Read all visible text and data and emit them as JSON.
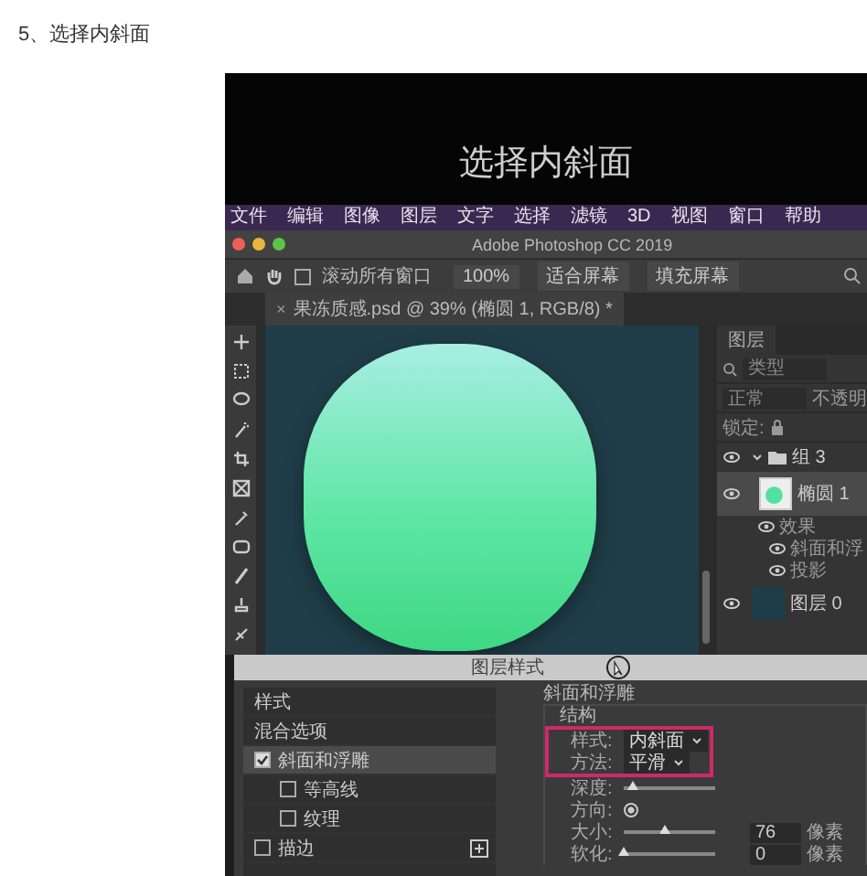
{
  "step_heading": "5、选择内斜面",
  "video": {
    "caption": "选择内斜面",
    "menu_bar": [
      "文件",
      "编辑",
      "图像",
      "图层",
      "文字",
      "选择",
      "滤镜",
      "3D",
      "视图",
      "窗口",
      "帮助"
    ],
    "title": "Adobe Photoshop CC 2019",
    "options_bar": {
      "scroll_all": {
        "label": "滚动所有窗口",
        "checked": false
      },
      "buttons": [
        "100%",
        "适合屏幕",
        "填充屏幕"
      ]
    },
    "document_tab": {
      "close_symbol": "×",
      "title": "果冻质感.psd @ 39% (椭圆 1, RGB/8) *"
    },
    "layers_panel": {
      "tab": "图层",
      "search_placeholder": "类型",
      "blend_mode": "正常",
      "opacity_label": "不透明",
      "lock_label": "锁定:",
      "layers": [
        {
          "name": "组 3",
          "kind": "group",
          "expanded": true,
          "selected": false,
          "children": [
            {
              "name": "椭圆 1",
              "kind": "shape",
              "selected": true,
              "effects_label": "效果",
              "effects": [
                "斜面和浮",
                "投影"
              ]
            }
          ]
        },
        {
          "name": "图层 0",
          "kind": "fill",
          "selected": false
        }
      ]
    },
    "dialog": {
      "title": "图层样式",
      "styles": [
        {
          "label": "样式",
          "kind": "plain",
          "selected": false
        },
        {
          "label": "混合选项",
          "kind": "plain",
          "selected": false
        },
        {
          "label": "斜面和浮雕",
          "kind": "check",
          "checked": true,
          "selected": true,
          "children": [
            {
              "label": "等高线",
              "kind": "check",
              "checked": false,
              "selected": false
            },
            {
              "label": "纹理",
              "kind": "check",
              "checked": false,
              "selected": false
            }
          ]
        },
        {
          "label": "描边",
          "kind": "check",
          "checked": false,
          "selected": false,
          "add": true
        }
      ],
      "section": "斜面和浮雕",
      "group": "结构",
      "fields": [
        {
          "kind": "select",
          "label": "样式:",
          "value": "内斜面",
          "highlighted": true
        },
        {
          "kind": "select",
          "label": "方法:",
          "value": "平滑",
          "highlighted": true
        },
        {
          "kind": "slider",
          "label": "深度:",
          "level": 0.1
        },
        {
          "kind": "radio",
          "label": "方向:",
          "options": [
            {
              "selected": true
            }
          ]
        },
        {
          "kind": "slider",
          "label": "大小:",
          "level": 0.45,
          "value": "76",
          "unit": "像素"
        },
        {
          "kind": "slider",
          "label": "软化:",
          "level": 0,
          "value": "0",
          "unit": "像素"
        }
      ]
    }
  }
}
